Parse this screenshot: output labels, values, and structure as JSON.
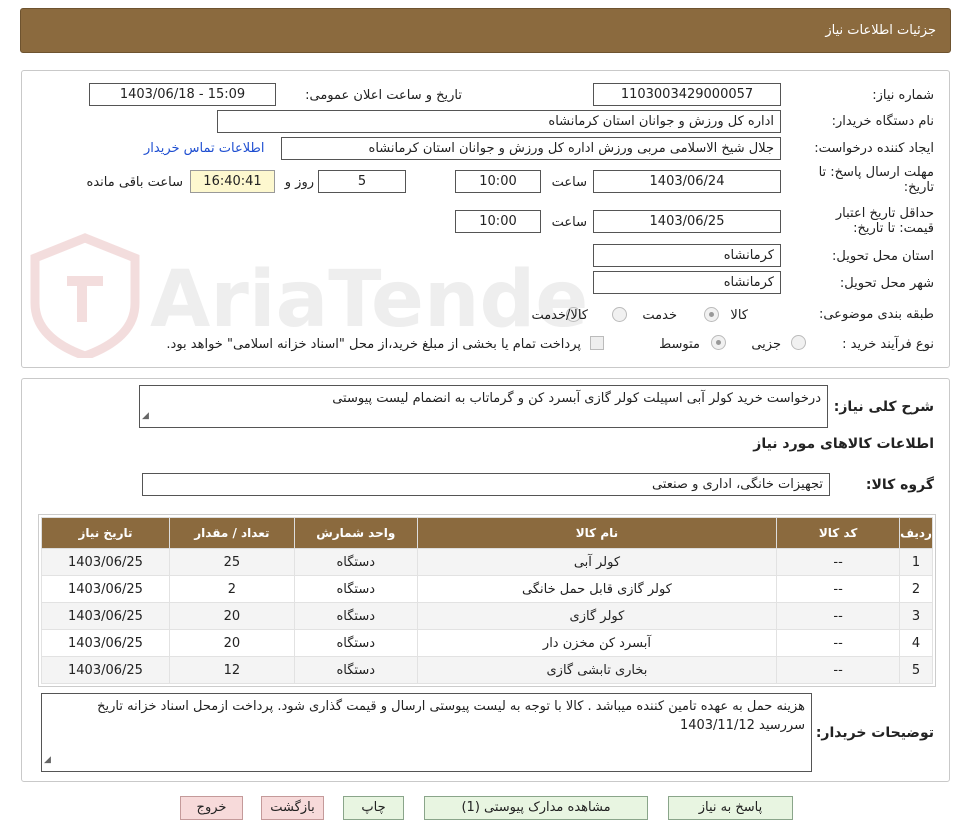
{
  "header": {
    "title": "جزئیات اطلاعات نیاز"
  },
  "labels": {
    "need_number": "شماره نیاز:",
    "announce_datetime": "تاریخ و ساعت اعلان عمومی:",
    "buyer_org": "نام دستگاه خریدار:",
    "requester": "ایجاد کننده درخواست:",
    "reply_deadline": "مهلت ارسال پاسخ: تا تاریخ:",
    "price_validity": "حداقل تاریخ اعتبار قیمت: تا تاریخ:",
    "time": "ساعت",
    "day_and": "روز و",
    "time_left": "ساعت باقی مانده",
    "delivery_province": "استان محل تحویل:",
    "delivery_city": "شهر محل تحویل:",
    "subject_category": "طبقه بندی موضوعی:",
    "purchase_process": "نوع فرآیند خرید :",
    "general_description": "شرح کلی نیاز:",
    "goods_info_title": "اطلاعات کالاهای مورد نیاز",
    "goods_group": "گروه کالا:",
    "buyer_notes": "توضیحات خریدار:"
  },
  "fields": {
    "need_number": "1103003429000057",
    "announce_datetime": "1403/06/18 - 15:09",
    "buyer_org": "اداره کل ورزش و جوانان استان کرمانشاه",
    "requester": "جلال شیخ الاسلامی مربی ورزش اداره کل ورزش و جوانان استان کرمانشاه",
    "contact_link": "اطلاعات تماس خریدار",
    "reply_date": "1403/06/24",
    "reply_time": "10:00",
    "days_left": "5",
    "countdown": "16:40:41",
    "validity_date": "1403/06/25",
    "validity_time": "10:00",
    "delivery_province": "کرمانشاه",
    "delivery_city": "کرمانشاه",
    "goods_group": "تجهیزات خانگی، اداری و صنعتی",
    "general_description": "درخواست خرید کولر آبی اسپیلت کولر گازی آبسرد کن و گرماتاب به انضمام لیست پیوستی",
    "buyer_notes": "هزینه حمل به عهده تامین کننده میباشد . کالا با توجه به لیست پیوستی ارسال و قیمت گذاری شود. پرداخت ازمحل اسناد خزانه تاریخ سررسید 1403/11/12"
  },
  "subject_options": [
    {
      "label": "کالا",
      "selected": true
    },
    {
      "label": "خدمت",
      "selected": false
    },
    {
      "label": "کالا/خدمت",
      "selected": false
    }
  ],
  "process_options": [
    {
      "label": "جزیی",
      "selected": false
    },
    {
      "label": "متوسط",
      "selected": true
    }
  ],
  "treasury_note": "پرداخت تمام یا بخشی از مبلغ خرید،از محل \"اسناد خزانه اسلامی\" خواهد بود.",
  "table": {
    "headers": [
      "ردیف",
      "کد کالا",
      "نام کالا",
      "واحد شمارش",
      "تعداد / مقدار",
      "تاریخ نیاز"
    ],
    "rows": [
      [
        "1",
        "--",
        "کولر آبی",
        "دستگاه",
        "25",
        "1403/06/25"
      ],
      [
        "2",
        "--",
        "کولر گازی قابل حمل خانگی",
        "دستگاه",
        "2",
        "1403/06/25"
      ],
      [
        "3",
        "--",
        "کولر گازی",
        "دستگاه",
        "20",
        "1403/06/25"
      ],
      [
        "4",
        "--",
        "آبسرد کن مخزن دار",
        "دستگاه",
        "20",
        "1403/06/25"
      ],
      [
        "5",
        "--",
        "بخاری تابشی گازی",
        "دستگاه",
        "12",
        "1403/06/25"
      ]
    ]
  },
  "buttons": {
    "reply": "پاسخ به نیاز",
    "view_docs": "مشاهده مدارک پیوستی (1)",
    "print": "چاپ",
    "back": "بازگشت",
    "exit": "خروج"
  },
  "watermark": {
    "text": "AriaTender.neT"
  },
  "colors": {
    "header_brown": "#8b6a3e",
    "link_blue": "#1f4fd1",
    "countdown_bg": "#fdf8cf",
    "button_green": "#e8f5e1",
    "button_red": "#f7dada"
  }
}
